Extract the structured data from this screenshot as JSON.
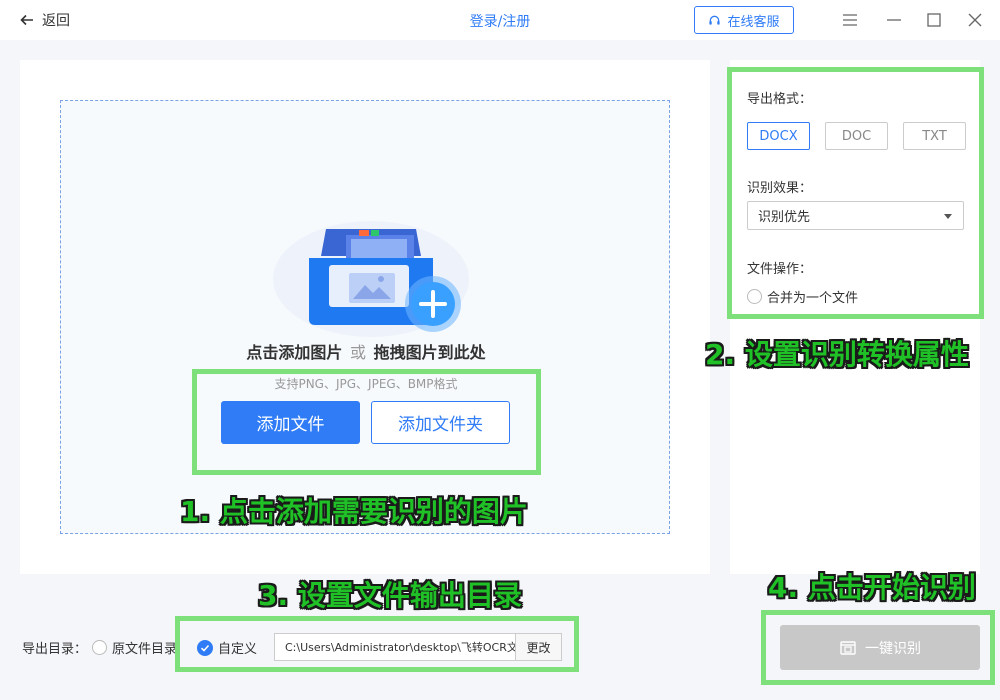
{
  "titlebar": {
    "back_label": "返回",
    "login_label": "登录/注册",
    "service_label": "在线客服"
  },
  "upload": {
    "drop_text_1": "点击添加图片",
    "drop_or": "或",
    "drop_text_2": "拖拽图片到此处",
    "formats": "支持PNG、JPG、JPEG、BMP格式",
    "add_file_label": "添加文件",
    "add_folder_label": "添加文件夹"
  },
  "settings": {
    "export_format_label": "导出格式：",
    "formats": [
      "DOCX",
      "DOC",
      "TXT"
    ],
    "selected_format": "DOCX",
    "recognition_label": "识别效果：",
    "recognition_value": "识别优先",
    "file_op_label": "文件操作：",
    "merge_label": "合并为一个文件"
  },
  "output": {
    "dir_label": "导出目录：",
    "original_dir_label": "原文件目录",
    "custom_label": "自定义",
    "path_value": "C:\\Users\\Administrator\\desktop\\飞转OCR文",
    "change_label": "更改"
  },
  "recognize_label": "一键识别",
  "annotations": {
    "step1": "1. 点击添加需要识别的图片",
    "step2": "2. 设置识别转换属性",
    "step3": "3. 设置文件输出目录",
    "step4": "4. 点击开始识别"
  },
  "colors": {
    "primary": "#2f7cf6",
    "highlight": "#7ee07a",
    "annotation_text": "#1fc126"
  }
}
